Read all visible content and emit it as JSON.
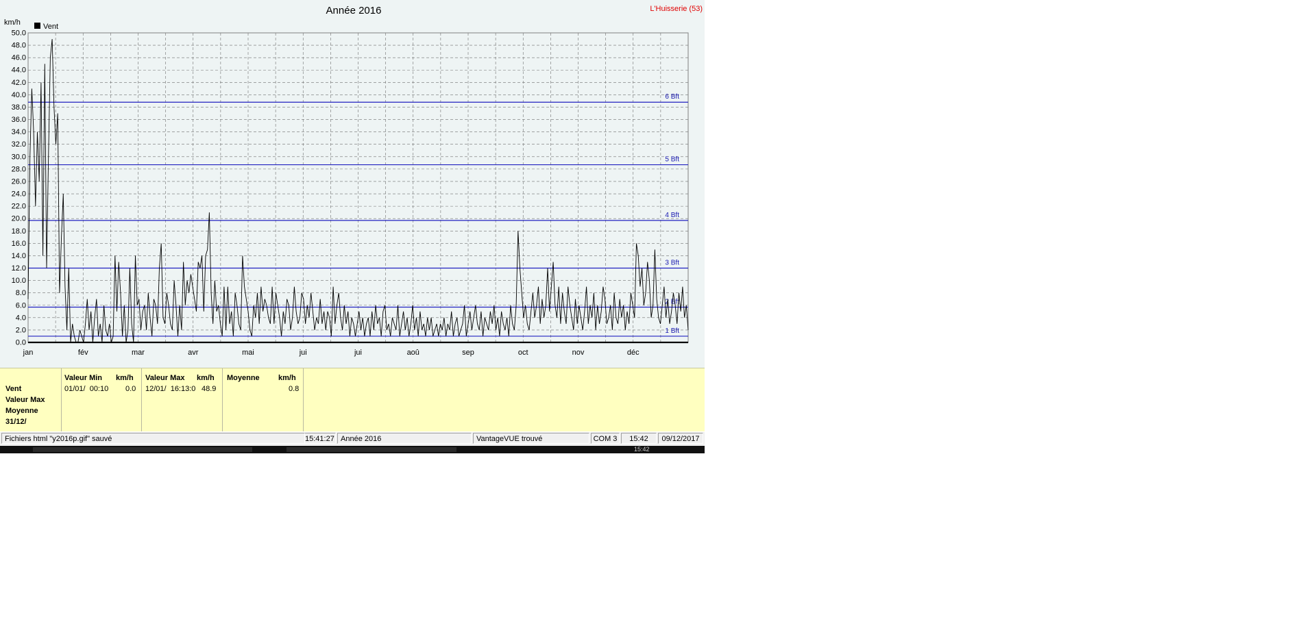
{
  "chart_data": {
    "type": "line",
    "title": "Année 2016",
    "station": "L'Huisserie (53)",
    "ylabel": "km/h",
    "xlabel": "",
    "ylim": [
      0,
      50
    ],
    "yticks": [
      "0.0",
      "2.0",
      "4.0",
      "6.0",
      "8.0",
      "10.0",
      "12.0",
      "14.0",
      "16.0",
      "18.0",
      "20.0",
      "22.0",
      "24.0",
      "26.0",
      "28.0",
      "30.0",
      "32.0",
      "34.0",
      "36.0",
      "38.0",
      "40.0",
      "42.0",
      "44.0",
      "46.0",
      "48.0",
      "50.0"
    ],
    "months": [
      "jan",
      "fév",
      "mar",
      "avr",
      "mai",
      "jui",
      "jui",
      "aoû",
      "sep",
      "oct",
      "nov",
      "déc"
    ],
    "legend": [
      {
        "name": "Vent",
        "color": "#000000"
      }
    ],
    "grid": true,
    "beaufort": [
      {
        "label": "1 Bft",
        "value": 1
      },
      {
        "label": "2 Bft",
        "value": 5.7
      },
      {
        "label": "3 Bft",
        "value": 12
      },
      {
        "label": "4 Bft",
        "value": 19.7
      },
      {
        "label": "5 Bft",
        "value": 28.7
      },
      {
        "label": "6 Bft",
        "value": 38.8
      }
    ],
    "series": [
      {
        "name": "Vent",
        "values_gust": [
          7,
          30,
          41,
          34,
          22,
          34,
          26,
          42,
          14,
          45,
          12,
          30,
          46,
          49,
          38,
          32,
          37,
          8,
          17,
          24,
          9,
          2,
          12,
          0,
          3,
          1,
          0,
          0,
          2,
          1,
          0,
          3,
          7,
          2,
          5,
          0,
          4,
          7,
          1,
          3,
          0,
          6,
          2,
          1,
          3,
          0,
          1,
          14,
          5,
          13,
          8,
          1,
          6,
          0,
          2,
          12,
          3,
          0,
          14,
          6,
          7,
          2,
          5,
          6,
          2,
          8,
          4,
          1,
          7,
          6,
          3,
          12,
          16,
          4,
          3,
          8,
          6,
          3,
          2,
          10,
          6,
          1,
          6,
          2,
          13,
          6,
          10,
          8,
          11,
          9,
          7,
          5,
          13,
          12,
          14,
          5,
          14,
          15,
          21,
          8,
          3,
          10,
          5,
          6,
          3,
          1,
          9,
          2,
          9,
          3,
          5,
          1,
          8,
          6,
          3,
          2,
          14,
          9,
          7,
          5,
          2,
          1,
          6,
          4,
          8,
          3,
          9,
          5,
          7,
          6,
          4,
          3,
          9,
          3,
          8,
          6,
          4,
          1,
          5,
          3,
          7,
          6,
          2,
          4,
          9,
          5,
          3,
          4,
          8,
          7,
          3,
          6,
          4,
          8,
          5,
          2,
          4,
          3,
          7,
          3,
          5,
          2,
          5,
          4,
          1,
          9,
          3,
          6,
          8,
          4,
          2,
          6,
          3,
          5,
          1,
          4,
          3,
          1,
          3,
          5,
          2,
          4,
          1,
          3,
          4,
          1,
          5,
          2,
          6,
          3,
          4,
          1,
          5,
          6,
          2,
          3,
          1,
          4,
          3,
          2,
          6,
          1,
          3,
          5,
          2,
          4,
          1,
          3,
          6,
          2,
          4,
          1,
          5,
          2,
          3,
          1,
          4,
          2,
          4,
          1,
          2,
          3,
          1,
          3,
          2,
          4,
          1,
          3,
          2,
          5,
          1,
          3,
          4,
          1,
          2,
          3,
          6,
          1,
          3,
          5,
          2,
          4,
          6,
          3,
          2,
          5,
          1,
          4,
          3,
          2,
          5,
          3,
          6,
          2,
          4,
          1,
          5,
          3,
          2,
          4,
          1,
          6,
          3,
          2,
          6,
          18,
          12,
          8,
          4,
          6,
          3,
          2,
          5,
          8,
          4,
          6,
          9,
          3,
          7,
          4,
          6,
          12,
          5,
          9,
          13,
          6,
          4,
          9,
          3,
          8,
          5,
          3,
          9,
          6,
          4,
          2,
          7,
          3,
          6,
          4,
          2,
          5,
          9,
          3,
          6,
          4,
          8,
          2,
          6,
          3,
          5,
          9,
          7,
          3,
          4,
          6,
          2,
          8,
          4,
          3,
          7,
          4,
          6,
          2,
          5,
          3,
          8,
          6,
          4,
          16,
          14,
          9,
          12,
          6,
          8,
          13,
          10,
          4,
          6,
          15,
          7,
          4,
          3,
          6,
          9,
          4,
          7,
          3,
          5,
          8,
          6,
          3,
          8,
          5,
          9,
          4,
          6,
          2
        ],
        "values_avg": [
          0,
          0,
          0,
          0,
          0,
          0,
          0,
          0,
          0,
          0,
          0,
          0,
          0,
          0,
          0,
          0,
          0,
          0,
          0,
          0,
          0,
          0,
          0,
          0,
          0,
          0,
          0,
          0,
          0,
          0,
          0,
          0,
          0,
          0,
          0,
          0,
          0,
          0,
          0,
          0,
          0,
          0,
          0,
          0,
          0,
          0,
          0,
          0,
          0,
          0,
          0,
          0,
          0,
          0,
          0,
          0,
          0,
          0,
          0,
          0,
          0,
          0,
          0,
          0,
          0,
          0,
          0,
          0,
          0,
          0,
          0,
          0,
          0,
          0,
          0,
          0,
          0,
          0,
          0,
          0,
          0,
          0,
          0,
          0,
          0,
          0,
          0,
          0,
          0,
          0,
          0,
          0,
          0,
          0,
          0,
          0,
          0,
          0,
          0,
          0,
          0,
          0,
          0,
          0,
          0,
          0,
          0,
          0,
          0,
          0,
          0,
          0,
          0,
          0,
          0,
          0,
          0,
          0,
          0,
          0,
          0,
          0,
          0,
          0,
          0,
          0,
          0,
          0,
          0,
          0,
          0,
          0,
          0,
          0,
          0,
          0,
          0,
          0,
          0,
          0,
          0,
          0,
          0,
          0,
          0,
          0,
          0,
          0,
          0,
          0,
          0,
          0,
          0,
          0,
          0,
          0,
          0,
          0,
          0,
          0,
          0,
          0,
          0,
          0,
          0,
          0,
          0,
          0,
          0,
          0,
          0,
          0,
          0,
          0,
          0,
          0,
          0,
          0,
          0,
          0,
          0,
          0,
          0,
          0,
          0,
          0,
          0,
          0,
          0,
          0,
          0,
          0,
          0,
          0,
          0,
          0,
          0,
          0,
          0,
          0,
          0,
          0,
          0,
          0,
          0,
          0,
          0,
          0,
          0,
          0,
          0,
          0,
          0,
          0,
          0,
          0,
          0,
          0,
          0,
          0,
          0,
          0,
          0,
          0,
          0,
          0,
          0,
          0,
          0,
          0,
          0,
          0,
          0,
          0,
          0,
          0,
          0,
          0,
          0,
          0,
          0,
          0,
          0,
          0,
          0,
          0,
          0,
          0,
          0,
          0,
          0,
          0,
          0,
          0,
          0,
          0,
          0,
          0,
          0,
          0,
          0,
          0,
          0,
          0,
          0,
          0,
          0,
          0,
          0,
          0,
          0,
          0,
          0,
          0,
          0,
          0,
          0,
          0,
          0,
          0,
          0,
          0,
          0,
          0,
          0,
          0,
          0,
          0,
          0,
          0,
          0,
          0,
          0,
          0,
          0,
          0,
          0,
          0,
          0,
          0,
          0,
          0,
          0,
          0,
          0,
          0,
          0,
          0,
          0,
          0,
          0,
          0,
          0,
          0,
          0,
          0,
          0,
          0,
          0,
          0,
          0,
          0,
          0,
          0,
          0,
          0,
          0,
          0,
          0,
          0,
          0,
          0,
          0,
          0,
          0,
          0,
          0,
          0,
          0,
          0,
          0,
          0,
          0,
          0
        ]
      }
    ]
  },
  "stats": {
    "col0": {
      "l1": "Vent",
      "l2": "Valeur Max",
      "l3": "Moyenne",
      "l4": "31/12/"
    },
    "col1": {
      "head": "Valeur Min",
      "unit": "km/h",
      "date": "01/01/  00:10",
      "value": "0.0"
    },
    "col2": {
      "head": "Valeur Max",
      "unit": "km/h",
      "date": "12/01/  16:13:0",
      "value": "48.9"
    },
    "col3": {
      "head": "Moyenne",
      "unit": "km/h",
      "value": "0.8"
    }
  },
  "status": {
    "message": "Fichiers html  \"y2016p.gif\"  sauvé",
    "time": "15:41:27",
    "period": "Année 2016",
    "device": "VantageVUE trouvé",
    "port": "COM 3",
    "clock": "15:42",
    "date": "09/12/2017"
  },
  "taskbar": {
    "clock": "15:42"
  }
}
